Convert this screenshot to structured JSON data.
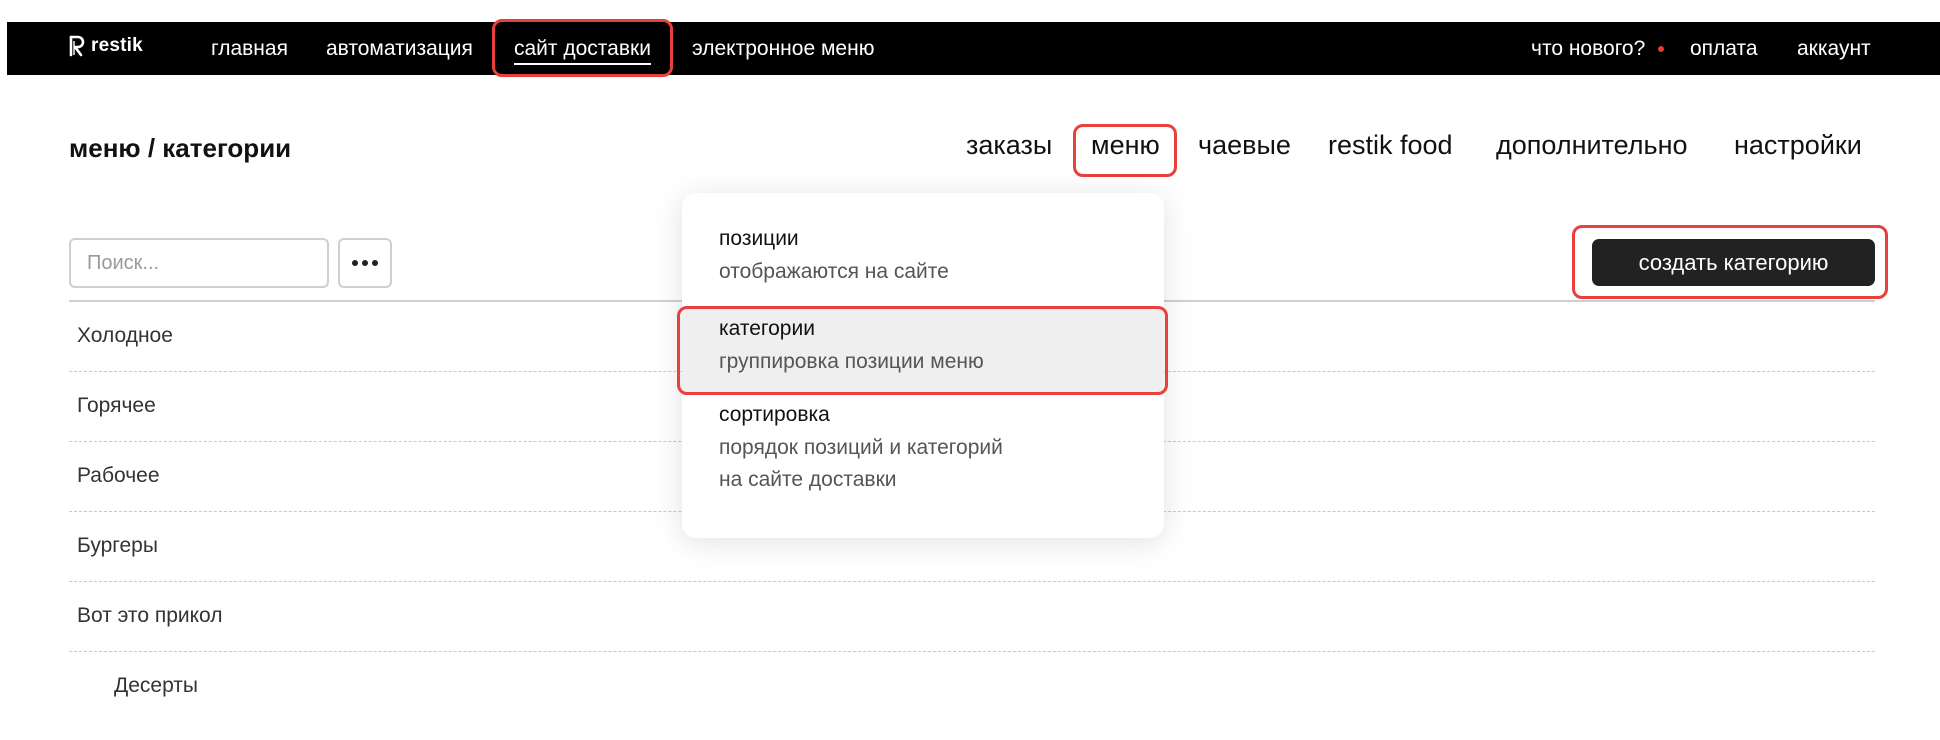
{
  "header": {
    "logo_text": "restik",
    "nav": [
      {
        "label": "главная"
      },
      {
        "label": "автоматизация"
      },
      {
        "label": "сайт доставки"
      },
      {
        "label": "электронное меню"
      }
    ],
    "right": [
      {
        "label": "что нового?"
      },
      {
        "label": "оплата"
      },
      {
        "label": "аккаунт"
      }
    ]
  },
  "page": {
    "title": "меню / категории",
    "tabs": [
      {
        "label": "заказы"
      },
      {
        "label": "меню"
      },
      {
        "label": "чаевые"
      },
      {
        "label": "restik food"
      },
      {
        "label": "дополнительно"
      },
      {
        "label": "настройки"
      }
    ]
  },
  "toolbar": {
    "search_placeholder": "Поиск...",
    "create_label": "создать категорию"
  },
  "categories": [
    {
      "name": "Холодное"
    },
    {
      "name": "Горячее"
    },
    {
      "name": "Рабочее"
    },
    {
      "name": "Бургеры"
    },
    {
      "name": "Вот это прикол"
    },
    {
      "name": "Десерты"
    }
  ],
  "dropdown": {
    "items": [
      {
        "title": "позиции",
        "desc": [
          "отображаются на сайте"
        ]
      },
      {
        "title": "категории",
        "desc": [
          "группировка позиции меню"
        ]
      },
      {
        "title": "сортировка",
        "desc": [
          "порядок позиций и категорий",
          "на сайте доставки"
        ]
      }
    ]
  },
  "colors": {
    "topbar": "#000000",
    "highlight": "#e8403a",
    "notification_dot": "#e53935",
    "primary_button": "#222222"
  },
  "icons": {
    "logo": "restik-r-logo-icon",
    "more": "more-dots-icon"
  }
}
